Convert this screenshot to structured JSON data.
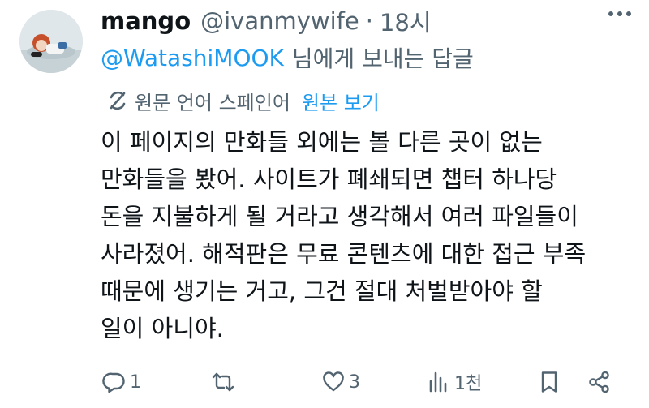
{
  "tweet": {
    "display_name": "mango",
    "handle": "@ivanmywife",
    "separator": "·",
    "time": "18시",
    "reply_to_handle": "@WatashiMOOK",
    "reply_to_suffix": "님에게 보내는 답글",
    "translation": {
      "label": "원문 언어 스페인어",
      "view_original": "원본 보기"
    },
    "body_lines": [
      "이 페이지의 만화들 외에는 볼 다른 곳이 없는",
      "만화들을 봤어. 사이트가 폐쇄되면 챕터 하나당",
      "돈을 지불하게 될 거라고 생각해서 여러 파일들이",
      "사라졌어. 해적판은 무료 콘텐츠에 대한 접근 부족",
      "때문에 생기는 거고, 그건 절대 처벌받아야 할",
      "일이 아니야."
    ],
    "actions": {
      "replies": "1",
      "retweets": "",
      "likes": "3",
      "views": "1천"
    }
  },
  "icons": {
    "translate": "translate-icon",
    "more": "more-icon",
    "reply": "reply-icon",
    "retweet": "retweet-icon",
    "like": "heart-icon",
    "views": "views-icon",
    "bookmark": "bookmark-icon",
    "share": "share-icon"
  },
  "colors": {
    "text": "#0f1419",
    "secondary": "#536471",
    "accent": "#1d9bf0"
  }
}
